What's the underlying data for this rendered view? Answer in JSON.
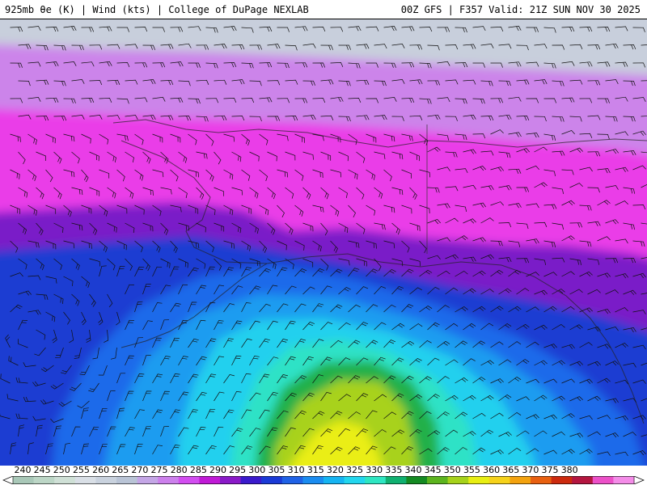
{
  "header": {
    "left_text": "925mb θe (K) | Wind (kts) | College of DuPage NEXLAB",
    "right_text": "00Z GFS | F357 Valid: 21Z SUN NOV 30 2025"
  },
  "legend": {
    "ticks": [
      "240",
      "245",
      "250",
      "255",
      "260",
      "265",
      "270",
      "275",
      "280",
      "285",
      "290",
      "295",
      "300",
      "305",
      "310",
      "315",
      "320",
      "325",
      "330",
      "335",
      "340",
      "345",
      "350",
      "355",
      "360",
      "365",
      "370",
      "375",
      "380"
    ],
    "colors": [
      "#a9c8b8",
      "#bcd6c6",
      "#cfe0d6",
      "#d9dfe6",
      "#c9d2de",
      "#b9c4d6",
      "#c4a6e6",
      "#cc80ec",
      "#d24df0",
      "#c01ad6",
      "#8a1ac8",
      "#3a1acc",
      "#1a3ad6",
      "#1f62e6",
      "#1a8cf0",
      "#15b4f2",
      "#22d6ee",
      "#2ee6c2",
      "#10b070",
      "#148a22",
      "#5cb41e",
      "#a6d21a",
      "#e8ee12",
      "#f6d21a",
      "#f3a20e",
      "#e86010",
      "#cc2a0e",
      "#b41640",
      "#ec50c8",
      "#f48ce8"
    ]
  },
  "map": {
    "field_colors": {
      "cold": "#c8cfdc",
      "lavender": "#cc84ea",
      "magenta": "#ea3ee8",
      "purple": "#7a1cc8",
      "deep_blue": "#1e3cd2",
      "blue": "#1f6aea",
      "sky": "#1a9cf0",
      "cyan": "#22d0ee",
      "teal": "#2ee2c6",
      "green": "#22b04a",
      "yellow_green": "#a8d21a",
      "yellow": "#eaee12"
    }
  }
}
